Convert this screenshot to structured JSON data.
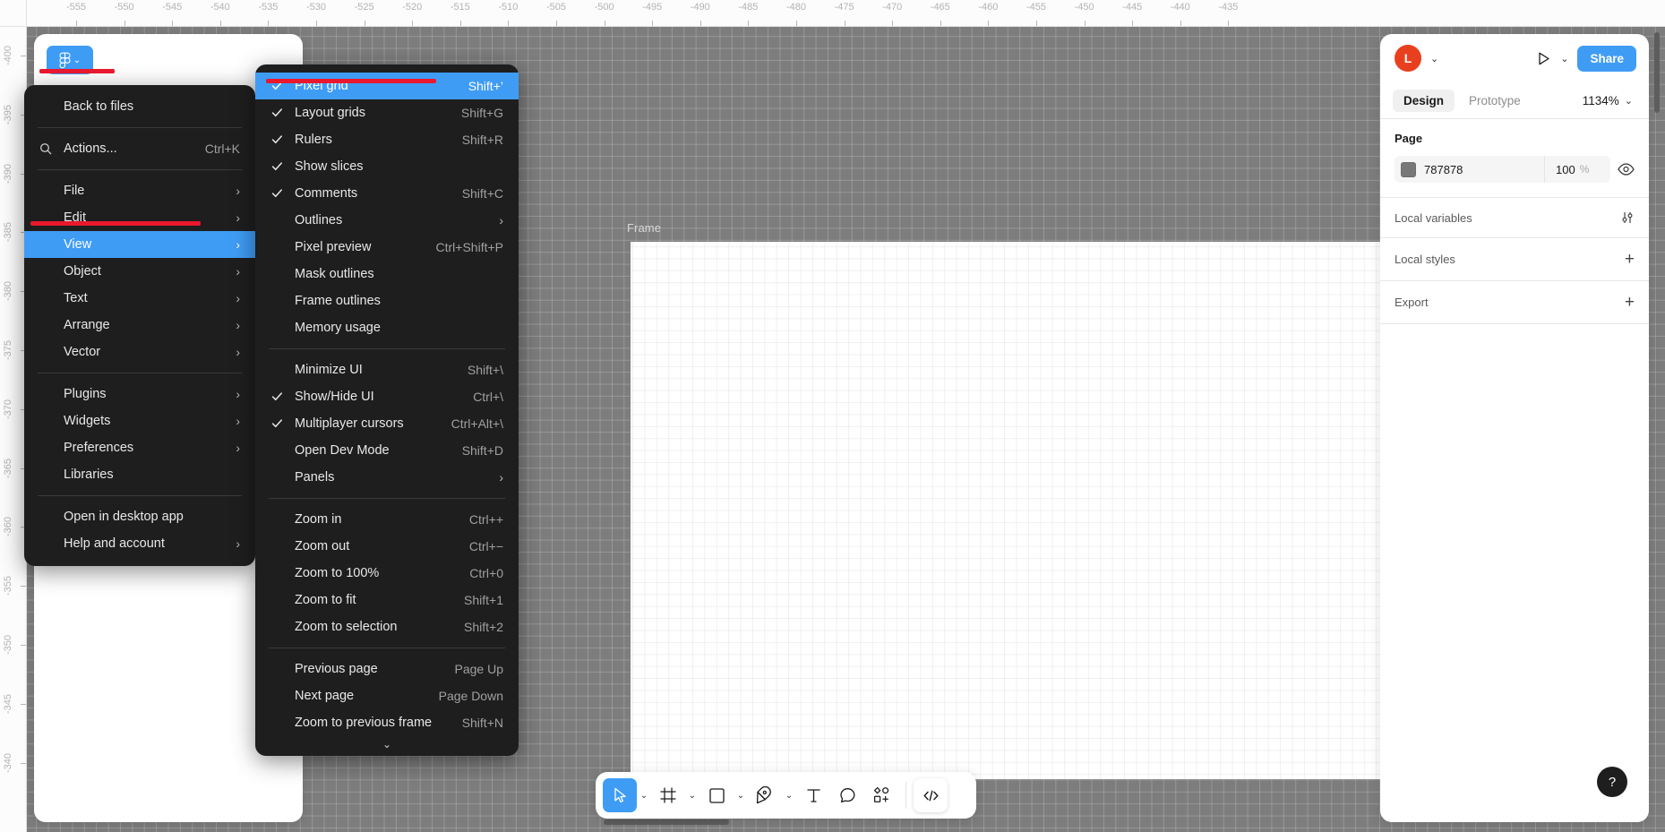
{
  "app": {
    "name": "Figma",
    "frame_label": "Frame"
  },
  "rulers": {
    "horizontal": [
      "-555",
      "-550",
      "-545",
      "-540",
      "-535",
      "-530",
      "-525",
      "-520",
      "-515",
      "-510",
      "-505",
      "-500",
      "-495",
      "-490",
      "-485",
      "-480",
      "-475",
      "-470",
      "-465",
      "-460",
      "-455",
      "-450",
      "-445",
      "-440",
      "-435"
    ],
    "vertical": [
      "-400",
      "-395",
      "-390",
      "-385",
      "-380",
      "-375",
      "-370",
      "-365",
      "-360",
      "-355",
      "-350",
      "-345",
      "-340"
    ]
  },
  "main_menu": {
    "groups": [
      [
        {
          "label": "Back to files",
          "shortcut": "",
          "icon": "",
          "submenu": false,
          "selected": false
        }
      ],
      [
        {
          "label": "Actions...",
          "shortcut": "Ctrl+K",
          "icon": "search-icon",
          "submenu": false,
          "selected": false
        }
      ],
      [
        {
          "label": "File",
          "shortcut": "",
          "icon": "",
          "submenu": true,
          "selected": false
        },
        {
          "label": "Edit",
          "shortcut": "",
          "icon": "",
          "submenu": true,
          "selected": false
        },
        {
          "label": "View",
          "shortcut": "",
          "icon": "",
          "submenu": true,
          "selected": true
        },
        {
          "label": "Object",
          "shortcut": "",
          "icon": "",
          "submenu": true,
          "selected": false
        },
        {
          "label": "Text",
          "shortcut": "",
          "icon": "",
          "submenu": true,
          "selected": false
        },
        {
          "label": "Arrange",
          "shortcut": "",
          "icon": "",
          "submenu": true,
          "selected": false
        },
        {
          "label": "Vector",
          "shortcut": "",
          "icon": "",
          "submenu": true,
          "selected": false
        }
      ],
      [
        {
          "label": "Plugins",
          "shortcut": "",
          "icon": "",
          "submenu": true,
          "selected": false
        },
        {
          "label": "Widgets",
          "shortcut": "",
          "icon": "",
          "submenu": true,
          "selected": false
        },
        {
          "label": "Preferences",
          "shortcut": "",
          "icon": "",
          "submenu": true,
          "selected": false
        },
        {
          "label": "Libraries",
          "shortcut": "",
          "icon": "",
          "submenu": false,
          "selected": false
        }
      ],
      [
        {
          "label": "Open in desktop app",
          "shortcut": "",
          "icon": "",
          "submenu": false,
          "selected": false
        },
        {
          "label": "Help and account",
          "shortcut": "",
          "icon": "",
          "submenu": true,
          "selected": false
        }
      ]
    ]
  },
  "view_submenu": {
    "groups": [
      [
        {
          "label": "Pixel grid",
          "shortcut": "Shift+’",
          "checked": true,
          "submenu": false,
          "selected": true
        },
        {
          "label": "Layout grids",
          "shortcut": "Shift+G",
          "checked": true,
          "submenu": false,
          "selected": false
        },
        {
          "label": "Rulers",
          "shortcut": "Shift+R",
          "checked": true,
          "submenu": false,
          "selected": false
        },
        {
          "label": "Show slices",
          "shortcut": "",
          "checked": true,
          "submenu": false,
          "selected": false
        },
        {
          "label": "Comments",
          "shortcut": "Shift+C",
          "checked": true,
          "submenu": false,
          "selected": false
        },
        {
          "label": "Outlines",
          "shortcut": "",
          "checked": false,
          "submenu": true,
          "selected": false
        },
        {
          "label": "Pixel preview",
          "shortcut": "Ctrl+Shift+P",
          "checked": false,
          "submenu": false,
          "selected": false
        },
        {
          "label": "Mask outlines",
          "shortcut": "",
          "checked": false,
          "submenu": false,
          "selected": false
        },
        {
          "label": "Frame outlines",
          "shortcut": "",
          "checked": false,
          "submenu": false,
          "selected": false
        },
        {
          "label": "Memory usage",
          "shortcut": "",
          "checked": false,
          "submenu": false,
          "selected": false
        }
      ],
      [
        {
          "label": "Minimize UI",
          "shortcut": "Shift+\\",
          "checked": false,
          "submenu": false,
          "selected": false
        },
        {
          "label": "Show/Hide UI",
          "shortcut": "Ctrl+\\",
          "checked": true,
          "submenu": false,
          "selected": false
        },
        {
          "label": "Multiplayer cursors",
          "shortcut": "Ctrl+Alt+\\",
          "checked": true,
          "submenu": false,
          "selected": false
        },
        {
          "label": "Open Dev Mode",
          "shortcut": "Shift+D",
          "checked": false,
          "submenu": false,
          "selected": false
        },
        {
          "label": "Panels",
          "shortcut": "",
          "checked": false,
          "submenu": true,
          "selected": false
        }
      ],
      [
        {
          "label": "Zoom in",
          "shortcut": "Ctrl++",
          "checked": false,
          "submenu": false,
          "selected": false
        },
        {
          "label": "Zoom out",
          "shortcut": "Ctrl+−",
          "checked": false,
          "submenu": false,
          "selected": false
        },
        {
          "label": "Zoom to 100%",
          "shortcut": "Ctrl+0",
          "checked": false,
          "submenu": false,
          "selected": false
        },
        {
          "label": "Zoom to fit",
          "shortcut": "Shift+1",
          "checked": false,
          "submenu": false,
          "selected": false
        },
        {
          "label": "Zoom to selection",
          "shortcut": "Shift+2",
          "checked": false,
          "submenu": false,
          "selected": false
        }
      ],
      [
        {
          "label": "Previous page",
          "shortcut": "Page Up",
          "checked": false,
          "submenu": false,
          "selected": false
        },
        {
          "label": "Next page",
          "shortcut": "Page Down",
          "checked": false,
          "submenu": false,
          "selected": false
        },
        {
          "label": "Zoom to previous frame",
          "shortcut": "Shift+N",
          "checked": false,
          "submenu": false,
          "selected": false
        }
      ]
    ]
  },
  "right_panel": {
    "avatar_initial": "L",
    "share_label": "Share",
    "tabs": [
      {
        "label": "Design",
        "active": true
      },
      {
        "label": "Prototype",
        "active": false
      }
    ],
    "zoom_level": "1134%",
    "page": {
      "title": "Page",
      "color_hex": "787878",
      "opacity": "100",
      "opacity_symbol": "%"
    },
    "rows": [
      {
        "label": "Local variables",
        "icon": "sliders-icon"
      },
      {
        "label": "Local styles",
        "icon": "plus-icon"
      },
      {
        "label": "Export",
        "icon": "plus-icon"
      }
    ]
  },
  "bottom_toolbar": {
    "tools": [
      {
        "name": "move-tool",
        "active": true,
        "chev": true
      },
      {
        "name": "frame-tool",
        "active": false,
        "chev": true
      },
      {
        "name": "shape-tool",
        "active": false,
        "chev": true
      },
      {
        "name": "pen-tool",
        "active": false,
        "chev": true
      },
      {
        "name": "text-tool",
        "active": false,
        "chev": false
      },
      {
        "name": "comment-tool",
        "active": false,
        "chev": false
      },
      {
        "name": "components-tool",
        "active": false,
        "chev": false
      }
    ],
    "dev_mode_label": "</>"
  },
  "help_button": {
    "label": "?"
  },
  "colors": {
    "accent_blue": "#3f9cf5",
    "highlight_red": "#e8182e",
    "menu_bg": "#1e1e1e",
    "avatar_orange": "#e8401f",
    "canvas_gray": "#7d7d7d"
  }
}
